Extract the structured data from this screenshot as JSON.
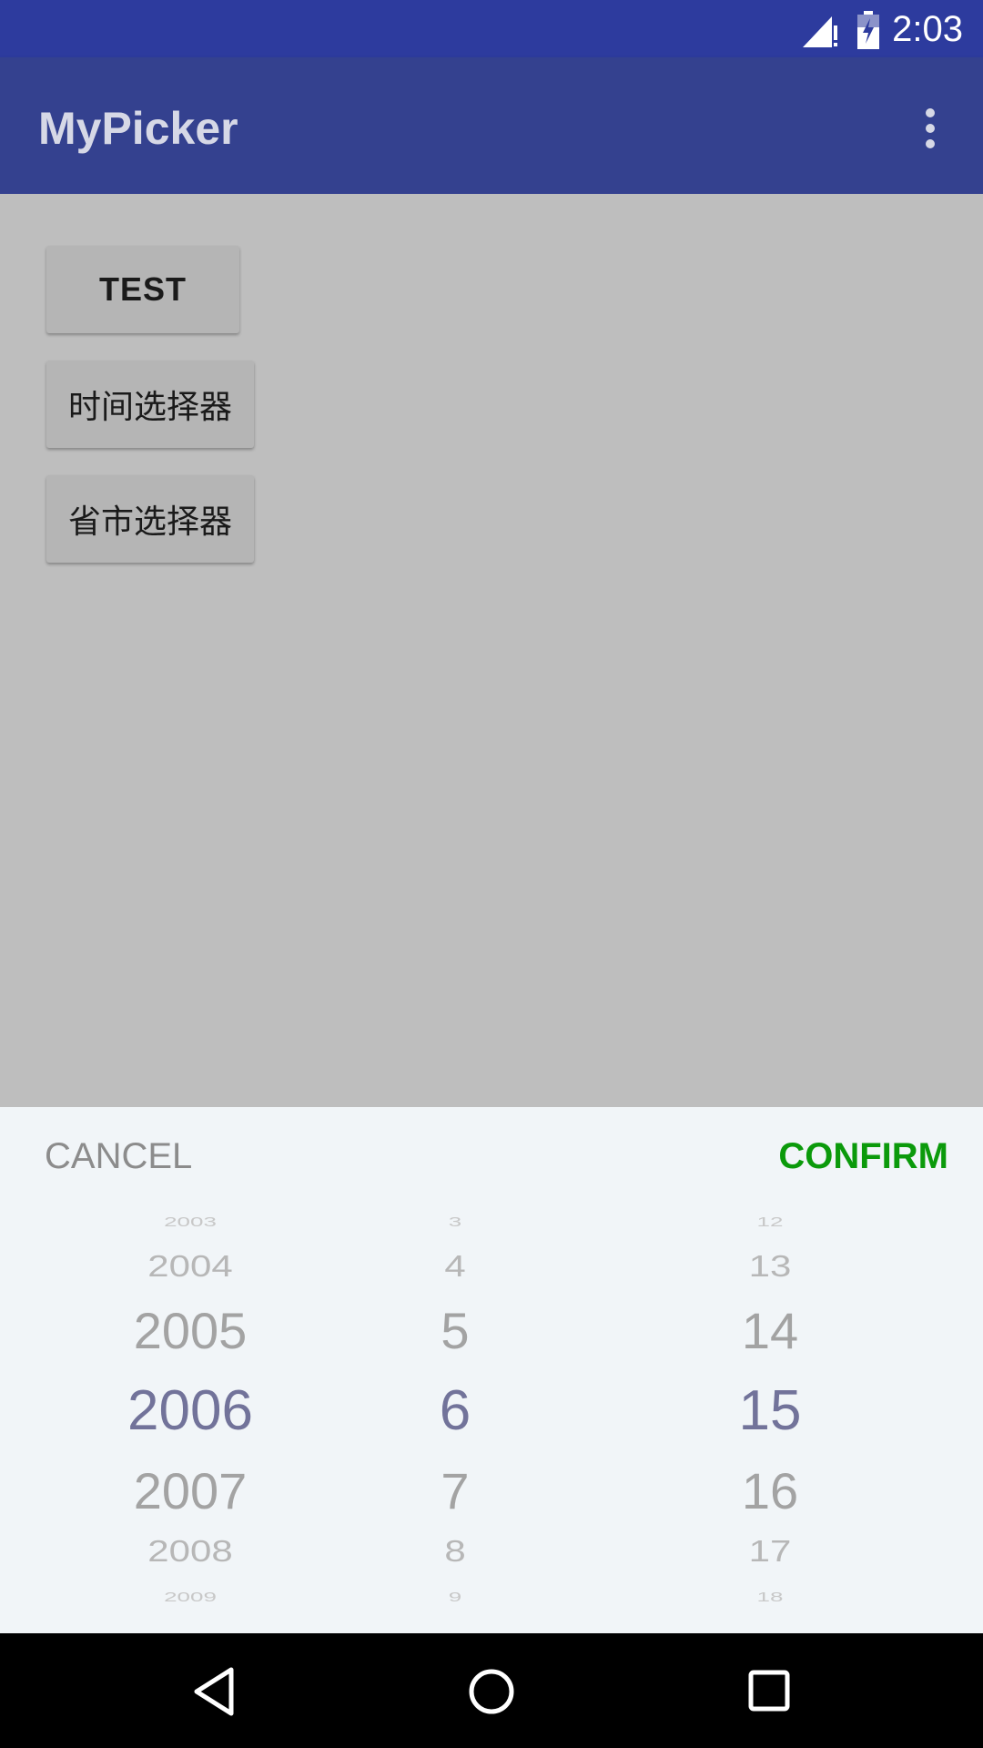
{
  "status_bar": {
    "time": "2:03",
    "icons": [
      "signal-no-data-icon",
      "battery-charging-icon"
    ]
  },
  "app_bar": {
    "title": "MyPicker",
    "menu_icon": "more-vert-icon"
  },
  "buttons": {
    "test": "TEST",
    "time_picker": "时间选择器",
    "city_picker": "省市选择器"
  },
  "picker": {
    "cancel": "CANCEL",
    "confirm": "CONFIRM",
    "confirm_color": "#0b9a0b",
    "selected_color": "#72739a",
    "year": [
      "2003",
      "2004",
      "2005",
      "2006",
      "2007",
      "2008",
      "2009"
    ],
    "month": [
      "3",
      "4",
      "5",
      "6",
      "7",
      "8",
      "9"
    ],
    "day": [
      "12",
      "13",
      "14",
      "15",
      "16",
      "17",
      "18"
    ],
    "selected": {
      "year": "2006",
      "month": "6",
      "day": "15"
    }
  },
  "nav_bar": {
    "icons": [
      "back-icon",
      "home-icon",
      "recents-icon"
    ]
  },
  "colors": {
    "status_bar": "#2d3b9e",
    "app_bar": "#34418f",
    "scrim": "#bebebe",
    "sheet": "#f1f5f8"
  }
}
